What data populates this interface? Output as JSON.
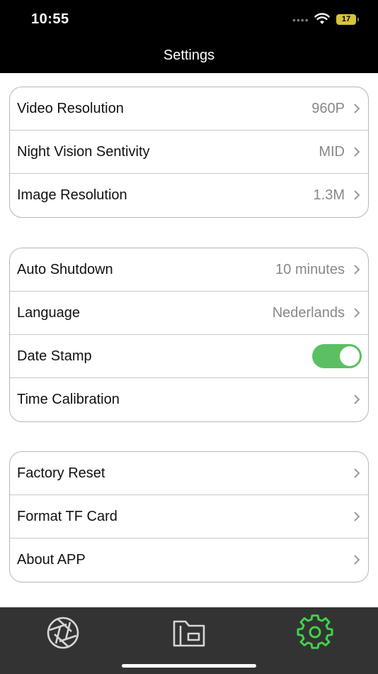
{
  "status": {
    "time": "10:55",
    "battery": "17"
  },
  "header": {
    "title": "Settings"
  },
  "group1": [
    {
      "label": "Video Resolution",
      "value": "960P"
    },
    {
      "label": "Night Vision Sentivity",
      "value": "MID"
    },
    {
      "label": "Image Resolution",
      "value": "1.3M"
    }
  ],
  "group2": [
    {
      "label": "Auto Shutdown",
      "value": "10 minutes"
    },
    {
      "label": "Language",
      "value": "Nederlands"
    },
    {
      "label": "Date Stamp",
      "toggle": true
    },
    {
      "label": "Time Calibration"
    }
  ],
  "group3": [
    {
      "label": "Factory Reset"
    },
    {
      "label": "Format TF Card"
    },
    {
      "label": "About APP"
    }
  ],
  "tabs": [
    {
      "icon": "aperture-icon",
      "active": false
    },
    {
      "icon": "folder-icon",
      "active": false
    },
    {
      "icon": "gear-icon",
      "active": true
    }
  ],
  "colors": {
    "toggle_on": "#5cbf63",
    "tab_active": "#3fd44a",
    "tab_inactive": "#d6d6d6",
    "bar_background": "#000000",
    "tabbar_background": "#333333"
  }
}
